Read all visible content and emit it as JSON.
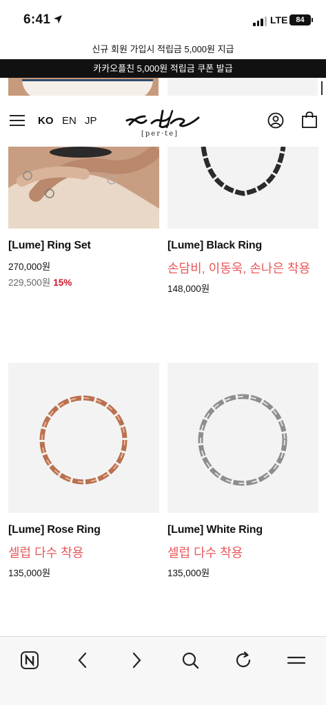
{
  "status_bar": {
    "time": "6:41",
    "network": "LTE",
    "battery": "84"
  },
  "promo": {
    "line1": "신규 회원 가입시 적립금 5,000원 지급",
    "line2": "카카오플친 5,000원 적립금 쿠폰 발급"
  },
  "header": {
    "languages": [
      "KO",
      "EN",
      "JP"
    ],
    "active_language": "KO",
    "logo_sub": "[per·te]"
  },
  "products": [
    {
      "name": "[Lume] Ring Set",
      "tag": "",
      "price": "270,000원",
      "sale_price": "229,500원",
      "discount": "15%"
    },
    {
      "name": "[Lume] Black Ring",
      "tag": "손담비, 이동욱, 손나은 착용",
      "price": "148,000원"
    },
    {
      "name": "[Lume] Rose Ring",
      "tag": "셀럽 다수 착용",
      "price": "135,000원"
    },
    {
      "name": "[Lume] White Ring",
      "tag": "셀럽 다수 착용",
      "price": "135,000원"
    }
  ],
  "colors": {
    "accent_tag": "#e8585a",
    "discount": "#d2142b",
    "banner": "#111111"
  },
  "toolbar": {
    "icons": [
      "naver-icon",
      "back-icon",
      "forward-icon",
      "search-icon",
      "refresh-icon",
      "menu-icon"
    ]
  }
}
